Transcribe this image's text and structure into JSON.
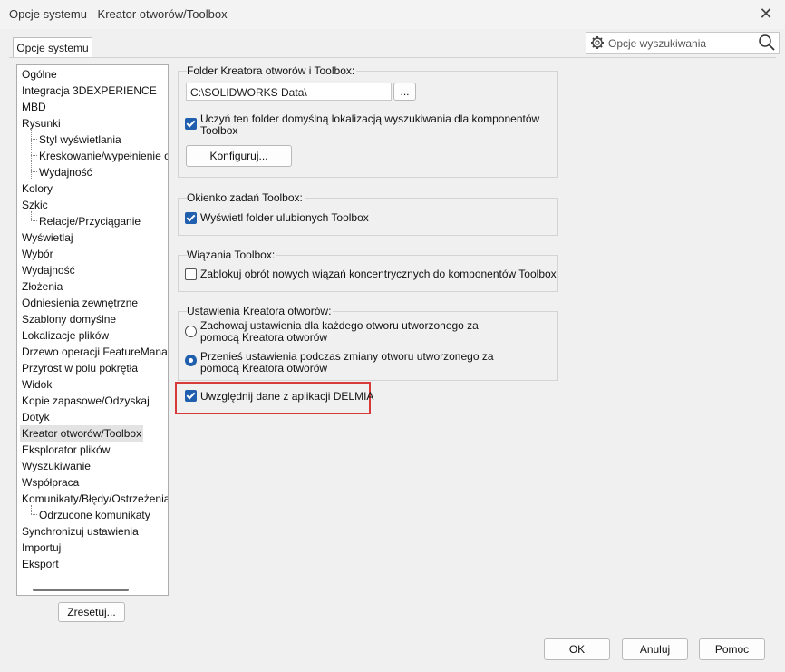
{
  "window": {
    "title": "Opcje systemu - Kreator otworów/Toolbox"
  },
  "tab": {
    "label": "Opcje systemu"
  },
  "search": {
    "placeholder": "Opcje wyszukiwania",
    "icon": "search-icon",
    "options_icon": "gear-icon"
  },
  "tree": {
    "items": [
      {
        "label": "Ogólne",
        "level": 0
      },
      {
        "label": "Integracja 3DEXPERIENCE",
        "level": 0
      },
      {
        "label": "MBD",
        "level": 0
      },
      {
        "label": "Rysunki",
        "level": 0
      },
      {
        "label": "Styl wyświetlania",
        "level": 1
      },
      {
        "label": "Kreskowanie/wypełnienie obszaru",
        "level": 1
      },
      {
        "label": "Wydajność",
        "level": 1
      },
      {
        "label": "Kolory",
        "level": 0
      },
      {
        "label": "Szkic",
        "level": 0
      },
      {
        "label": "Relacje/Przyciąganie",
        "level": 1
      },
      {
        "label": "Wyświetlaj",
        "level": 0
      },
      {
        "label": "Wybór",
        "level": 0
      },
      {
        "label": "Wydajność",
        "level": 0
      },
      {
        "label": "Złożenia",
        "level": 0
      },
      {
        "label": "Odniesienia zewnętrzne",
        "level": 0
      },
      {
        "label": "Szablony domyślne",
        "level": 0
      },
      {
        "label": "Lokalizacje plików",
        "level": 0
      },
      {
        "label": "Drzewo operacji FeatureManager",
        "level": 0
      },
      {
        "label": "Przyrost w polu pokrętła",
        "level": 0
      },
      {
        "label": "Widok",
        "level": 0
      },
      {
        "label": "Kopie zapasowe/Odzyskaj",
        "level": 0
      },
      {
        "label": "Dotyk",
        "level": 0
      },
      {
        "label": "Kreator otworów/Toolbox",
        "level": 0,
        "selected": true
      },
      {
        "label": "Eksplorator plików",
        "level": 0
      },
      {
        "label": "Wyszukiwanie",
        "level": 0
      },
      {
        "label": "Współpraca",
        "level": 0
      },
      {
        "label": "Komunikaty/Błędy/Ostrzeżenia",
        "level": 0
      },
      {
        "label": "Odrzucone komunikaty",
        "level": 1
      },
      {
        "label": "Synchronizuj ustawienia",
        "level": 0
      },
      {
        "label": "Importuj",
        "level": 0
      },
      {
        "label": "Eksport",
        "level": 0
      }
    ]
  },
  "reset_button": "Zresetuj...",
  "groups": {
    "folder": {
      "title": "Folder Kreatora otworów i Toolbox:",
      "path_value": "C:\\SOLIDWORKS Data\\",
      "browse_label": "...",
      "default_search_checkbox": {
        "label": "Uczyń ten folder domyślną lokalizacją wyszukiwania dla komponentów Toolbox",
        "checked": true
      },
      "configure_button": "Konfiguruj..."
    },
    "taskpane": {
      "title": "Okienko zadań Toolbox:",
      "favorites_checkbox": {
        "label": "Wyświetl folder ulubionych Toolbox",
        "checked": true
      }
    },
    "mates": {
      "title": "Wiązania Toolbox:",
      "lock_checkbox": {
        "label": "Zablokuj obrót nowych wiązań koncentrycznych do komponentów Toolbox",
        "checked": false
      }
    },
    "hole_wizard": {
      "title": "Ustawienia Kreatora otworów:",
      "radio_keep": {
        "label": "Zachowaj ustawienia dla każdego otworu utworzonego za pomocą Kreatora otworów",
        "selected": false
      },
      "radio_carry": {
        "label": "Przenieś ustawienia podczas zmiany otworu utworzonego za pomocą Kreatora otworów",
        "selected": true
      }
    }
  },
  "delmia_checkbox": {
    "label": "Uwzględnij dane z aplikacji DELMIA",
    "checked": true
  },
  "footer": {
    "ok": "OK",
    "cancel": "Anuluj",
    "help": "Pomoc"
  },
  "colors": {
    "accent": "#1f5fad",
    "highlight": "#d83a3a"
  }
}
